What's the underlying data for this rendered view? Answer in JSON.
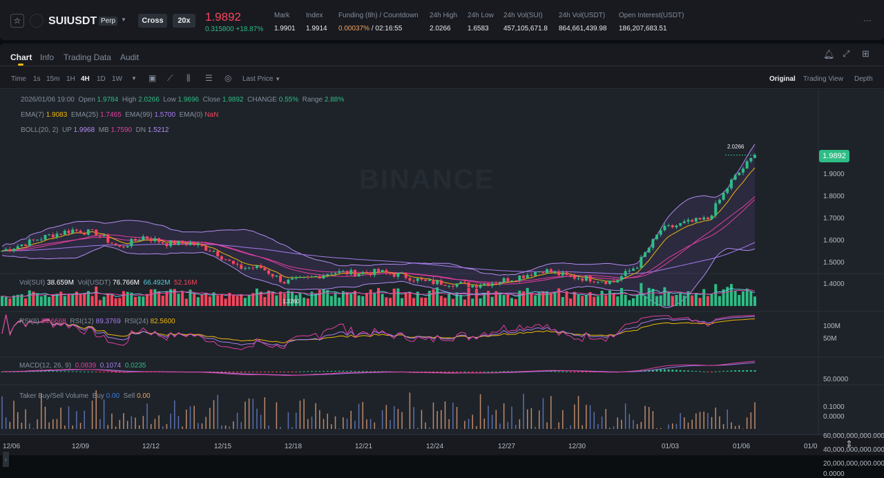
{
  "header": {
    "symbol": "SUIUSDT",
    "contract": "Perp",
    "margin": "Cross",
    "leverage": "20x",
    "last_price": "1.9892",
    "change": "0.315800 +18.87%",
    "stats": [
      {
        "label": "Mark",
        "value": "1.9901"
      },
      {
        "label": "Index",
        "value": "1.9914"
      },
      {
        "label": "Funding (8h) / Countdown",
        "value": "0.00037%",
        "value2": " / 02:16:55"
      },
      {
        "label": "24h High",
        "value": "2.0266"
      },
      {
        "label": "24h Low",
        "value": "1.6583"
      },
      {
        "label": "24h Vol(SUI)",
        "value": "457,105,671.8"
      },
      {
        "label": "24h Vol(USDT)",
        "value": "864,661,439.98"
      },
      {
        "label": "Open Interest(USDT)",
        "value": "186,207,683.51"
      }
    ],
    "more": "···"
  },
  "tabs": [
    "Chart",
    "Info",
    "Trading Data",
    "Audit"
  ],
  "toolbar": {
    "time": "Time",
    "intervals": [
      "1s",
      "15m",
      "1H",
      "4H",
      "1D",
      "1W"
    ],
    "active_interval": "4H",
    "price_type": "Last Price",
    "views": [
      "Original",
      "Trading View",
      "Depth"
    ],
    "active_view": "Original"
  },
  "legend": {
    "ohlc": {
      "date": "2026/01/06 19:00",
      "open_l": "Open",
      "open": "1.9784",
      "high_l": "High",
      "high": "2.0266",
      "low_l": "Low",
      "low": "1.9696",
      "close_l": "Close",
      "close": "1.9892",
      "change_l": "CHANGE",
      "change": "0.55%",
      "range_l": "Range",
      "range": "2.88%"
    },
    "ema": {
      "l7": "EMA(7)",
      "v7": "1.9083",
      "l25": "EMA(25)",
      "v25": "1.7465",
      "l99": "EMA(99)",
      "v99": "1.5700",
      "l0": "EMA(0)",
      "v0": "NaN"
    },
    "boll": {
      "l": "BOLL(20, 2)",
      "up_l": "UP",
      "up": "1.9968",
      "mb_l": "MB",
      "mb": "1.7590",
      "dn_l": "DN",
      "dn": "1.5212"
    },
    "vol": {
      "l1": "Vol(SUI)",
      "v1": "38.659M",
      "l2": "Vol(USDT)",
      "v2": "76.766M",
      "v3": "66.492M",
      "v4": "52.16M"
    },
    "rsi": {
      "l6": "RSI(6)",
      "v6": "94.6668",
      "l12": "RSI(12)",
      "v12": "89.3769",
      "l24": "RSI(24)",
      "v24": "82.5600"
    },
    "macd": {
      "l": "MACD(12, 26, 9)",
      "v1": "0.0839",
      "v2": "0.1074",
      "v3": "0.0235"
    },
    "taker": {
      "l": "Taker Buy/Sell Volume",
      "buy_l": "Buy",
      "buy": "0.00",
      "sell_l": "Sell",
      "sell": "0.00"
    }
  },
  "watermark": "BINANCE",
  "price_axis": [
    "1.9000",
    "1.8000",
    "1.7000",
    "1.6000",
    "1.5000",
    "1.4000"
  ],
  "current_price_tag": "1.9892",
  "high_marker": "2.0266",
  "low_marker": "1.3260",
  "vol_axis": [
    "100M",
    "50M"
  ],
  "rsi_axis": "50.0000",
  "macd_axis": [
    "0.1000",
    "0.0000"
  ],
  "taker_axis": [
    "60,000,000,000.0000",
    "40,000,000,000.0000",
    "20,000,000,000.0000",
    "0.0000"
  ],
  "dates": [
    "12/06",
    "12/09",
    "12/12",
    "12/15",
    "12/18",
    "12/21",
    "12/24",
    "12/27",
    "12/30",
    "01/03",
    "01/06",
    "01/0"
  ],
  "colors": {
    "up": "#2ebd85",
    "down": "#f6465d",
    "price": "#f6465d",
    "ema7": "#f0b90b",
    "ema25": "#e23fa0",
    "ema99": "#a77cf0",
    "boll": "#b48cf2"
  },
  "chart_data": {
    "type": "candlestick",
    "interval": "4H",
    "daily_closes": [
      1.556,
      1.59,
      1.625,
      1.65,
      1.635,
      1.57,
      1.62,
      1.59,
      1.59,
      1.556,
      1.48,
      1.48,
      1.415,
      1.43,
      1.46,
      1.455,
      1.46,
      1.445,
      1.415,
      1.41,
      1.4,
      1.415,
      1.44,
      1.47,
      1.44,
      1.43,
      1.415,
      1.49,
      1.65,
      1.68,
      1.7,
      1.87,
      1.9892
    ]
  }
}
